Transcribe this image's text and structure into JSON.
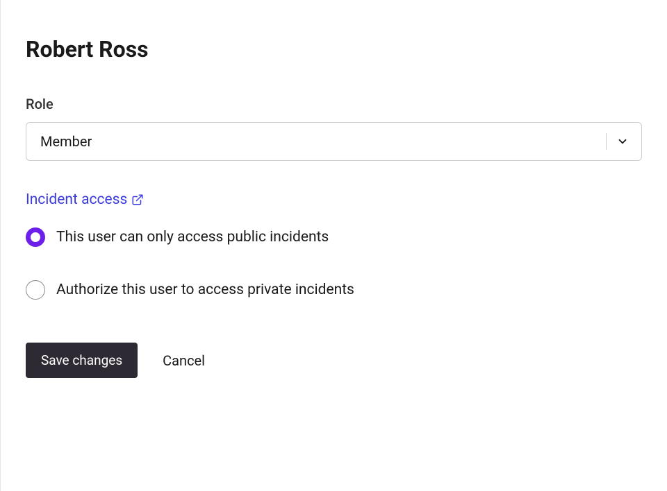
{
  "header": {
    "title": "Robert Ross"
  },
  "role": {
    "label": "Role",
    "selected": "Member"
  },
  "incident_access": {
    "link_text": "Incident access",
    "options": [
      {
        "label": "This user can only access public incidents",
        "selected": true
      },
      {
        "label": "Authorize this user to access private incidents",
        "selected": false
      }
    ]
  },
  "actions": {
    "save": "Save changes",
    "cancel": "Cancel"
  },
  "colors": {
    "accent": "#6c1fe8",
    "link": "#3b3bdd",
    "primary_button_bg": "#2e2a33"
  }
}
